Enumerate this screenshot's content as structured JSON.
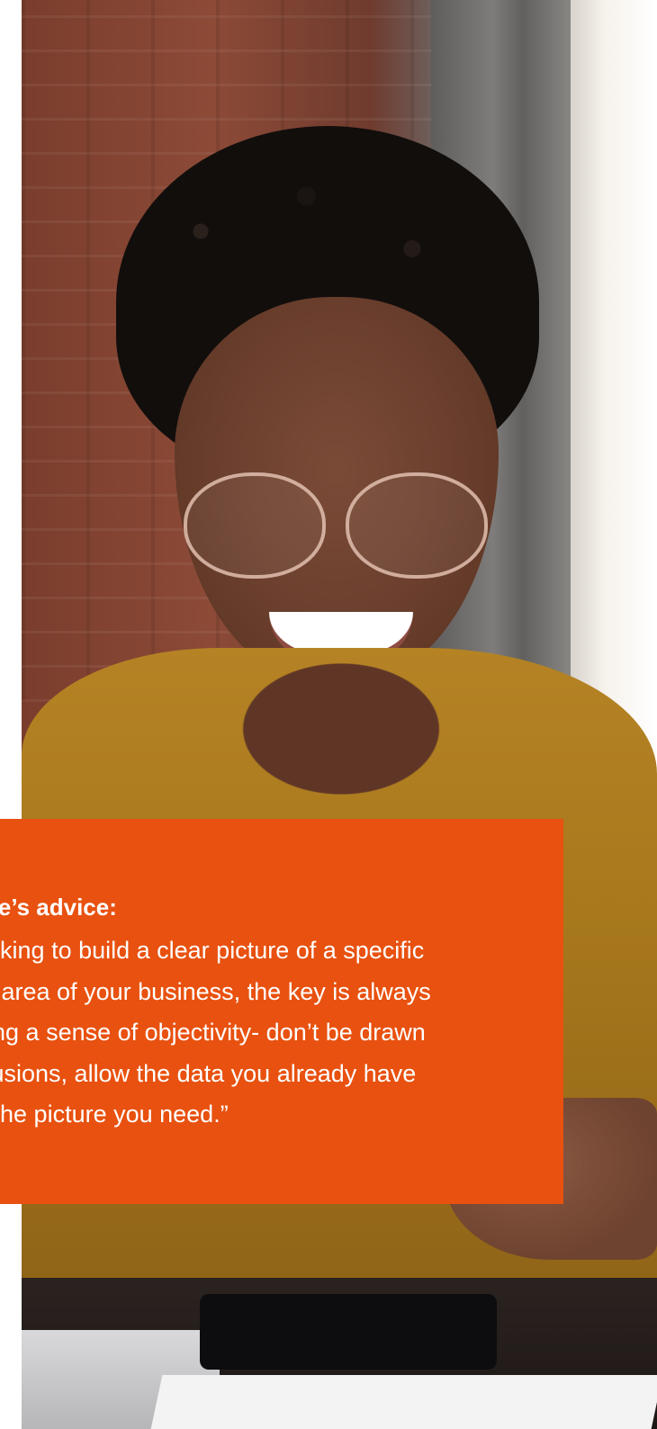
{
  "hero_image": {
    "alt": "",
    "colors": {
      "brick": "#8c4a37",
      "shirt": "#b58324",
      "skin": "#6a3e2d"
    }
  },
  "quote_card": {
    "background": "#e8510f",
    "heading": "ne’s advice:",
    "lines": [
      "ooking to build a clear picture of a specific",
      "or area of your business, the key is always",
      "ning a sense of objectivity- don’t be drawn",
      "clusions, allow the data you already have",
      "e the picture you need.”"
    ]
  }
}
